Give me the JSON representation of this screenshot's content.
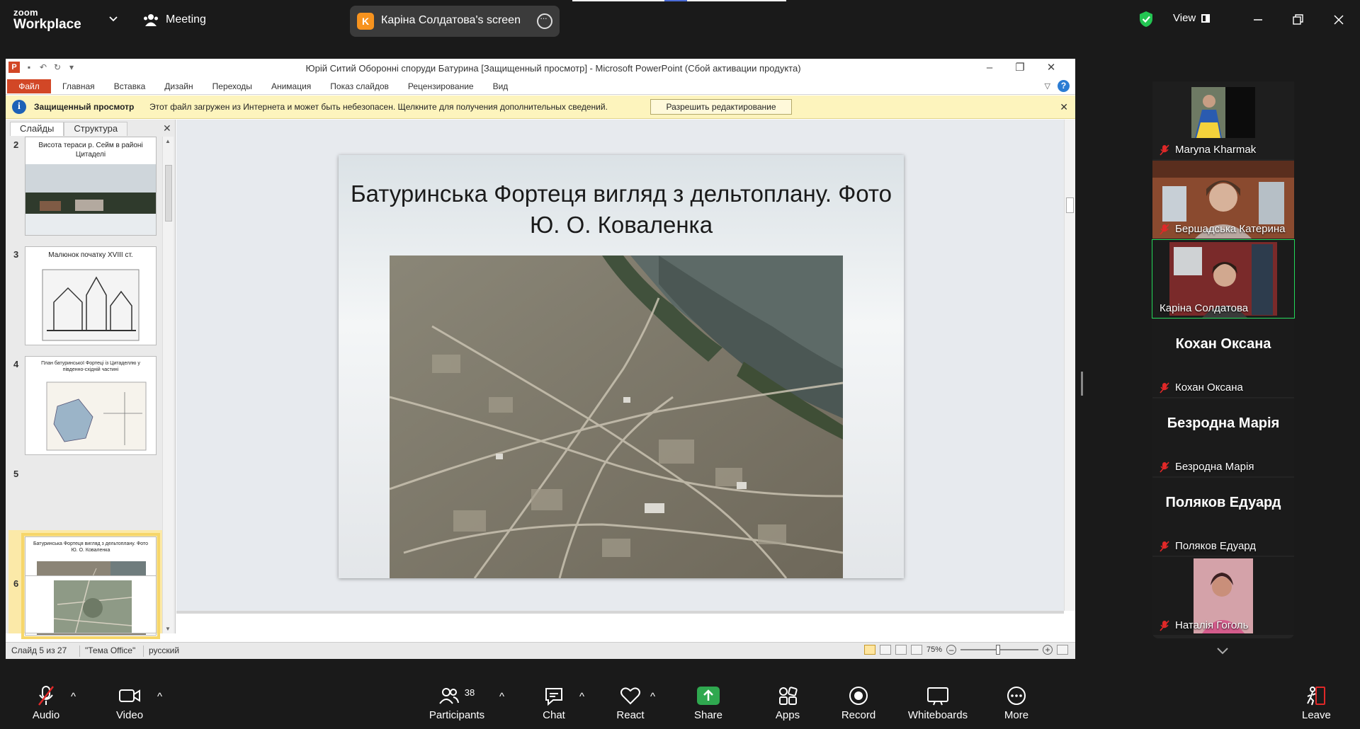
{
  "zoom": {
    "brand_small": "zoom",
    "brand_big": "Workplace",
    "meeting_label": "Meeting",
    "share_initial": "K",
    "share_title": "Каріна Солдатова's screen",
    "view_label": "View"
  },
  "ppt": {
    "window_title": "Юрій Ситий Оборонні споруди Батурина [Защищенный просмотр]  -  Microsoft PowerPoint (Сбой активации продукта)",
    "file_tab": "Файл",
    "tabs": [
      "Главная",
      "Вставка",
      "Дизайн",
      "Переходы",
      "Анимация",
      "Показ слайдов",
      "Рецензирование",
      "Вид"
    ],
    "protected_label": "Защищенный просмотр",
    "protected_text": "Этот файл загружен из Интернета и может быть небезопасен. Щелкните для получения дополнительных сведений.",
    "enable_edit_button": "Разрешить редактирование",
    "pane_tabs": [
      "Слайды",
      "Структура"
    ],
    "thumbnails": [
      {
        "num": "2",
        "title": "Висота тераси р. Сейм в районі Цитаделі"
      },
      {
        "num": "3",
        "title": "Малюнок початку XVIII ст."
      },
      {
        "num": "4",
        "title": "План батуринської Фортеці із Цитаделлю у південно-східній частині"
      },
      {
        "num": "5",
        "title": "Батуринська Фортеця вигляд з дельтоплану. Фото Ю. О. Коваленка"
      },
      {
        "num": "6",
        "title": ""
      }
    ],
    "slide_title": "Батуринська Фортеця вигляд з дельтоплану. Фото Ю. О. Коваленка",
    "status_slide": "Слайд 5 из 27",
    "status_theme": "\"Тема Office\"",
    "status_lang": "русский",
    "zoom_level": "75%"
  },
  "participants_tiles": [
    {
      "name": "Maryna Kharmak",
      "type": "video"
    },
    {
      "name": "Бершадська Катерина",
      "type": "video"
    },
    {
      "name": "Каріна Солдатова",
      "type": "video",
      "active": true
    },
    {
      "name": "Кохан Оксана",
      "type": "name",
      "big": "Кохан Оксана"
    },
    {
      "name": "Безродна Марія",
      "type": "name",
      "big": "Безродна Марія"
    },
    {
      "name": "Поляков Едуард",
      "type": "name",
      "big": "Поляков Едуард"
    },
    {
      "name": "Наталія Гоголь",
      "type": "video"
    }
  ],
  "toolbar": {
    "audio": "Audio",
    "video": "Video",
    "participants": "Participants",
    "participants_count": "38",
    "chat": "Chat",
    "react": "React",
    "share": "Share",
    "apps": "Apps",
    "record": "Record",
    "whiteboards": "Whiteboards",
    "more": "More",
    "leave": "Leave"
  },
  "colors": {
    "ppt_accent": "#d24726",
    "active_speaker": "#23d959",
    "share_green": "#2fa84f",
    "mute_red": "#e02828"
  }
}
